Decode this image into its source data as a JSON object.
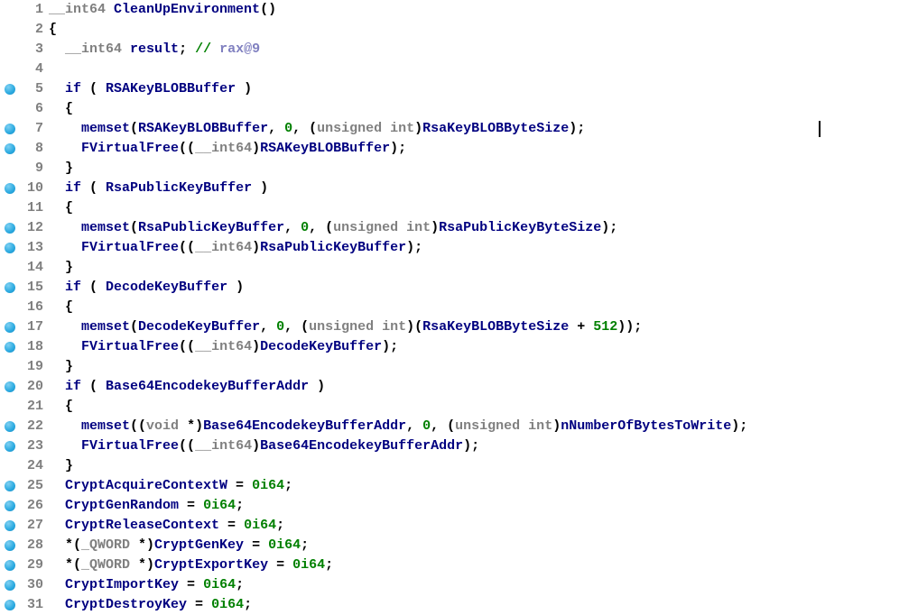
{
  "lines": [
    {
      "n": 1,
      "bp": false,
      "tokens": [
        [
          "typ",
          "__int64"
        ],
        [
          "pun",
          " "
        ],
        [
          "id",
          "CleanUpEnvironment"
        ],
        [
          "pun",
          "()"
        ]
      ]
    },
    {
      "n": 2,
      "bp": false,
      "tokens": [
        [
          "pun",
          "{"
        ]
      ]
    },
    {
      "n": 3,
      "bp": false,
      "tokens": [
        [
          "pun",
          "  "
        ],
        [
          "typ",
          "__int64"
        ],
        [
          "pun",
          " "
        ],
        [
          "id",
          "result"
        ],
        [
          "pun",
          "; "
        ],
        [
          "cslash",
          "// "
        ],
        [
          "cvar",
          "rax@9"
        ]
      ]
    },
    {
      "n": 4,
      "bp": false,
      "tokens": []
    },
    {
      "n": 5,
      "bp": true,
      "tokens": [
        [
          "pun",
          "  "
        ],
        [
          "kw",
          "if"
        ],
        [
          "pun",
          " ( "
        ],
        [
          "id",
          "RSAKeyBLOBBuffer"
        ],
        [
          "pun",
          " )"
        ]
      ]
    },
    {
      "n": 6,
      "bp": false,
      "tokens": [
        [
          "pun",
          "  {"
        ]
      ]
    },
    {
      "n": 7,
      "bp": true,
      "tokens": [
        [
          "pun",
          "    "
        ],
        [
          "fn",
          "memset"
        ],
        [
          "pun",
          "("
        ],
        [
          "id",
          "RSAKeyBLOBBuffer"
        ],
        [
          "pun",
          ", "
        ],
        [
          "num",
          "0"
        ],
        [
          "pun",
          ", ("
        ],
        [
          "typ",
          "unsigned int"
        ],
        [
          "pun",
          ")"
        ],
        [
          "id",
          "RsaKeyBLOBByteSize"
        ],
        [
          "pun",
          ");"
        ]
      ]
    },
    {
      "n": 8,
      "bp": true,
      "tokens": [
        [
          "pun",
          "    "
        ],
        [
          "fn",
          "FVirtualFree"
        ],
        [
          "pun",
          "(("
        ],
        [
          "typ",
          "__int64"
        ],
        [
          "pun",
          ")"
        ],
        [
          "id",
          "RSAKeyBLOBBuffer"
        ],
        [
          "pun",
          ");"
        ]
      ]
    },
    {
      "n": 9,
      "bp": false,
      "tokens": [
        [
          "pun",
          "  }"
        ]
      ]
    },
    {
      "n": 10,
      "bp": true,
      "tokens": [
        [
          "pun",
          "  "
        ],
        [
          "kw",
          "if"
        ],
        [
          "pun",
          " ( "
        ],
        [
          "id",
          "RsaPublicKeyBuffer"
        ],
        [
          "pun",
          " )"
        ]
      ]
    },
    {
      "n": 11,
      "bp": false,
      "tokens": [
        [
          "pun",
          "  {"
        ]
      ]
    },
    {
      "n": 12,
      "bp": true,
      "tokens": [
        [
          "pun",
          "    "
        ],
        [
          "fn",
          "memset"
        ],
        [
          "pun",
          "("
        ],
        [
          "id",
          "RsaPublicKeyBuffer"
        ],
        [
          "pun",
          ", "
        ],
        [
          "num",
          "0"
        ],
        [
          "pun",
          ", ("
        ],
        [
          "typ",
          "unsigned int"
        ],
        [
          "pun",
          ")"
        ],
        [
          "id",
          "RsaPublicKeyByteSize"
        ],
        [
          "pun",
          ");"
        ]
      ]
    },
    {
      "n": 13,
      "bp": true,
      "tokens": [
        [
          "pun",
          "    "
        ],
        [
          "fn",
          "FVirtualFree"
        ],
        [
          "pun",
          "(("
        ],
        [
          "typ",
          "__int64"
        ],
        [
          "pun",
          ")"
        ],
        [
          "id",
          "RsaPublicKeyBuffer"
        ],
        [
          "pun",
          ");"
        ]
      ]
    },
    {
      "n": 14,
      "bp": false,
      "tokens": [
        [
          "pun",
          "  }"
        ]
      ]
    },
    {
      "n": 15,
      "bp": true,
      "tokens": [
        [
          "pun",
          "  "
        ],
        [
          "kw",
          "if"
        ],
        [
          "pun",
          " ( "
        ],
        [
          "id",
          "DecodeKeyBuffer"
        ],
        [
          "pun",
          " )"
        ]
      ]
    },
    {
      "n": 16,
      "bp": false,
      "tokens": [
        [
          "pun",
          "  {"
        ]
      ]
    },
    {
      "n": 17,
      "bp": true,
      "tokens": [
        [
          "pun",
          "    "
        ],
        [
          "fn",
          "memset"
        ],
        [
          "pun",
          "("
        ],
        [
          "id",
          "DecodeKeyBuffer"
        ],
        [
          "pun",
          ", "
        ],
        [
          "num",
          "0"
        ],
        [
          "pun",
          ", ("
        ],
        [
          "typ",
          "unsigned int"
        ],
        [
          "pun",
          ")("
        ],
        [
          "id",
          "RsaKeyBLOBByteSize"
        ],
        [
          "pun",
          " + "
        ],
        [
          "num",
          "512"
        ],
        [
          "pun",
          "));"
        ]
      ]
    },
    {
      "n": 18,
      "bp": true,
      "tokens": [
        [
          "pun",
          "    "
        ],
        [
          "fn",
          "FVirtualFree"
        ],
        [
          "pun",
          "(("
        ],
        [
          "typ",
          "__int64"
        ],
        [
          "pun",
          ")"
        ],
        [
          "id",
          "DecodeKeyBuffer"
        ],
        [
          "pun",
          ");"
        ]
      ]
    },
    {
      "n": 19,
      "bp": false,
      "tokens": [
        [
          "pun",
          "  }"
        ]
      ]
    },
    {
      "n": 20,
      "bp": true,
      "tokens": [
        [
          "pun",
          "  "
        ],
        [
          "kw",
          "if"
        ],
        [
          "pun",
          " ( "
        ],
        [
          "id",
          "Base64EncodekeyBufferAddr"
        ],
        [
          "pun",
          " )"
        ]
      ]
    },
    {
      "n": 21,
      "bp": false,
      "tokens": [
        [
          "pun",
          "  {"
        ]
      ]
    },
    {
      "n": 22,
      "bp": true,
      "tokens": [
        [
          "pun",
          "    "
        ],
        [
          "fn",
          "memset"
        ],
        [
          "pun",
          "(("
        ],
        [
          "typ",
          "void "
        ],
        [
          "pun",
          "*)"
        ],
        [
          "id",
          "Base64EncodekeyBufferAddr"
        ],
        [
          "pun",
          ", "
        ],
        [
          "num",
          "0"
        ],
        [
          "pun",
          ", ("
        ],
        [
          "typ",
          "unsigned int"
        ],
        [
          "pun",
          ")"
        ],
        [
          "id",
          "nNumberOfBytesToWrite"
        ],
        [
          "pun",
          ");"
        ]
      ]
    },
    {
      "n": 23,
      "bp": true,
      "tokens": [
        [
          "pun",
          "    "
        ],
        [
          "fn",
          "FVirtualFree"
        ],
        [
          "pun",
          "(("
        ],
        [
          "typ",
          "__int64"
        ],
        [
          "pun",
          ")"
        ],
        [
          "id",
          "Base64EncodekeyBufferAddr"
        ],
        [
          "pun",
          ");"
        ]
      ]
    },
    {
      "n": 24,
      "bp": false,
      "tokens": [
        [
          "pun",
          "  }"
        ]
      ]
    },
    {
      "n": 25,
      "bp": true,
      "tokens": [
        [
          "pun",
          "  "
        ],
        [
          "id",
          "CryptAcquireContextW"
        ],
        [
          "pun",
          " = "
        ],
        [
          "num",
          "0i64"
        ],
        [
          "pun",
          ";"
        ]
      ]
    },
    {
      "n": 26,
      "bp": true,
      "tokens": [
        [
          "pun",
          "  "
        ],
        [
          "id",
          "CryptGenRandom"
        ],
        [
          "pun",
          " = "
        ],
        [
          "num",
          "0i64"
        ],
        [
          "pun",
          ";"
        ]
      ]
    },
    {
      "n": 27,
      "bp": true,
      "tokens": [
        [
          "pun",
          "  "
        ],
        [
          "id",
          "CryptReleaseContext"
        ],
        [
          "pun",
          " = "
        ],
        [
          "num",
          "0i64"
        ],
        [
          "pun",
          ";"
        ]
      ]
    },
    {
      "n": 28,
      "bp": true,
      "tokens": [
        [
          "pun",
          "  *("
        ],
        [
          "typ",
          "_QWORD "
        ],
        [
          "pun",
          "*)"
        ],
        [
          "id",
          "CryptGenKey"
        ],
        [
          "pun",
          " = "
        ],
        [
          "num",
          "0i64"
        ],
        [
          "pun",
          ";"
        ]
      ]
    },
    {
      "n": 29,
      "bp": true,
      "tokens": [
        [
          "pun",
          "  *("
        ],
        [
          "typ",
          "_QWORD "
        ],
        [
          "pun",
          "*)"
        ],
        [
          "id",
          "CryptExportKey"
        ],
        [
          "pun",
          " = "
        ],
        [
          "num",
          "0i64"
        ],
        [
          "pun",
          ";"
        ]
      ]
    },
    {
      "n": 30,
      "bp": true,
      "tokens": [
        [
          "pun",
          "  "
        ],
        [
          "id",
          "CryptImportKey"
        ],
        [
          "pun",
          " = "
        ],
        [
          "num",
          "0i64"
        ],
        [
          "pun",
          ";"
        ]
      ]
    },
    {
      "n": 31,
      "bp": true,
      "tokens": [
        [
          "pun",
          "  "
        ],
        [
          "id",
          "CryptDestroyKey"
        ],
        [
          "pun",
          " = "
        ],
        [
          "num",
          "0i64"
        ],
        [
          "pun",
          ";"
        ]
      ]
    }
  ]
}
